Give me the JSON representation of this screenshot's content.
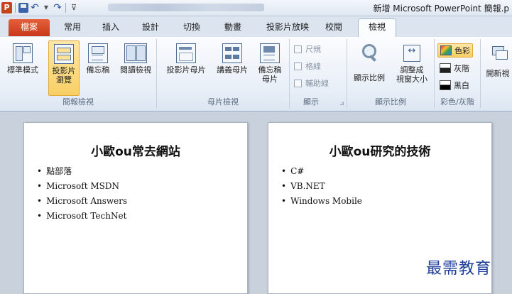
{
  "window": {
    "title": "新增 Microsoft PowerPoint 簡報.p",
    "logo_text": "P",
    "qat_undo": "↶",
    "qat_redo": "↷",
    "qat_custom": "⊽"
  },
  "tabs": [
    {
      "label": "檔案"
    },
    {
      "label": "常用"
    },
    {
      "label": "插入"
    },
    {
      "label": "設計"
    },
    {
      "label": "切換"
    },
    {
      "label": "動畫"
    },
    {
      "label": "投影片放映"
    },
    {
      "label": "校閱"
    },
    {
      "label": "檢視"
    }
  ],
  "ribbon": {
    "presentation_views": {
      "label": "簡報檢視",
      "normal": "標準模式",
      "slide_sorter_1": "投影片",
      "slide_sorter_2": "瀏覽",
      "notes_page": "備忘稿",
      "reading_view": "閱讀檢視"
    },
    "master_views": {
      "label": "母片檢視",
      "slide_master": "投影片母片",
      "handout_master": "講義母片",
      "notes_master_1": "備忘稿",
      "notes_master_2": "母片"
    },
    "show": {
      "label": "顯示",
      "ruler": "尺規",
      "gridlines": "格線",
      "guides": "輔助線",
      "launcher": "⊿"
    },
    "zoom": {
      "label": "顯示比例",
      "zoom": "顯示比例",
      "fit_1": "調整成",
      "fit_2": "視窗大小"
    },
    "color": {
      "label": "彩色/灰階",
      "color": "色彩",
      "grayscale": "灰階",
      "bw": "黑白"
    },
    "window": {
      "new_window": "開新視"
    }
  },
  "slides": [
    {
      "title": "小歐ou常去網站",
      "bullets": [
        "點部落",
        "Microsoft MSDN",
        "Microsoft Answers",
        "Microsoft TechNet"
      ]
    },
    {
      "title": "小歐ou研究的技術",
      "bullets": [
        "C#",
        "VB.NET",
        "Windows Mobile"
      ]
    }
  ],
  "watermark": "最需教育"
}
